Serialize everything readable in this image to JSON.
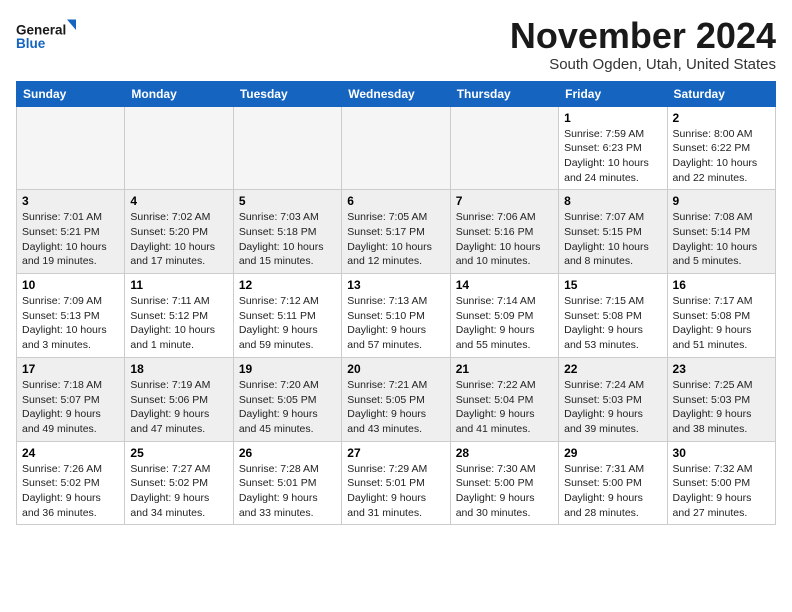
{
  "logo": {
    "line1": "General",
    "line2": "Blue"
  },
  "title": "November 2024",
  "subtitle": "South Ogden, Utah, United States",
  "weekdays": [
    "Sunday",
    "Monday",
    "Tuesday",
    "Wednesday",
    "Thursday",
    "Friday",
    "Saturday"
  ],
  "weeks": [
    [
      {
        "day": "",
        "info": ""
      },
      {
        "day": "",
        "info": ""
      },
      {
        "day": "",
        "info": ""
      },
      {
        "day": "",
        "info": ""
      },
      {
        "day": "",
        "info": ""
      },
      {
        "day": "1",
        "info": "Sunrise: 7:59 AM\nSunset: 6:23 PM\nDaylight: 10 hours\nand 24 minutes."
      },
      {
        "day": "2",
        "info": "Sunrise: 8:00 AM\nSunset: 6:22 PM\nDaylight: 10 hours\nand 22 minutes."
      }
    ],
    [
      {
        "day": "3",
        "info": "Sunrise: 7:01 AM\nSunset: 5:21 PM\nDaylight: 10 hours\nand 19 minutes."
      },
      {
        "day": "4",
        "info": "Sunrise: 7:02 AM\nSunset: 5:20 PM\nDaylight: 10 hours\nand 17 minutes."
      },
      {
        "day": "5",
        "info": "Sunrise: 7:03 AM\nSunset: 5:18 PM\nDaylight: 10 hours\nand 15 minutes."
      },
      {
        "day": "6",
        "info": "Sunrise: 7:05 AM\nSunset: 5:17 PM\nDaylight: 10 hours\nand 12 minutes."
      },
      {
        "day": "7",
        "info": "Sunrise: 7:06 AM\nSunset: 5:16 PM\nDaylight: 10 hours\nand 10 minutes."
      },
      {
        "day": "8",
        "info": "Sunrise: 7:07 AM\nSunset: 5:15 PM\nDaylight: 10 hours\nand 8 minutes."
      },
      {
        "day": "9",
        "info": "Sunrise: 7:08 AM\nSunset: 5:14 PM\nDaylight: 10 hours\nand 5 minutes."
      }
    ],
    [
      {
        "day": "10",
        "info": "Sunrise: 7:09 AM\nSunset: 5:13 PM\nDaylight: 10 hours\nand 3 minutes."
      },
      {
        "day": "11",
        "info": "Sunrise: 7:11 AM\nSunset: 5:12 PM\nDaylight: 10 hours\nand 1 minute."
      },
      {
        "day": "12",
        "info": "Sunrise: 7:12 AM\nSunset: 5:11 PM\nDaylight: 9 hours\nand 59 minutes."
      },
      {
        "day": "13",
        "info": "Sunrise: 7:13 AM\nSunset: 5:10 PM\nDaylight: 9 hours\nand 57 minutes."
      },
      {
        "day": "14",
        "info": "Sunrise: 7:14 AM\nSunset: 5:09 PM\nDaylight: 9 hours\nand 55 minutes."
      },
      {
        "day": "15",
        "info": "Sunrise: 7:15 AM\nSunset: 5:08 PM\nDaylight: 9 hours\nand 53 minutes."
      },
      {
        "day": "16",
        "info": "Sunrise: 7:17 AM\nSunset: 5:08 PM\nDaylight: 9 hours\nand 51 minutes."
      }
    ],
    [
      {
        "day": "17",
        "info": "Sunrise: 7:18 AM\nSunset: 5:07 PM\nDaylight: 9 hours\nand 49 minutes."
      },
      {
        "day": "18",
        "info": "Sunrise: 7:19 AM\nSunset: 5:06 PM\nDaylight: 9 hours\nand 47 minutes."
      },
      {
        "day": "19",
        "info": "Sunrise: 7:20 AM\nSunset: 5:05 PM\nDaylight: 9 hours\nand 45 minutes."
      },
      {
        "day": "20",
        "info": "Sunrise: 7:21 AM\nSunset: 5:05 PM\nDaylight: 9 hours\nand 43 minutes."
      },
      {
        "day": "21",
        "info": "Sunrise: 7:22 AM\nSunset: 5:04 PM\nDaylight: 9 hours\nand 41 minutes."
      },
      {
        "day": "22",
        "info": "Sunrise: 7:24 AM\nSunset: 5:03 PM\nDaylight: 9 hours\nand 39 minutes."
      },
      {
        "day": "23",
        "info": "Sunrise: 7:25 AM\nSunset: 5:03 PM\nDaylight: 9 hours\nand 38 minutes."
      }
    ],
    [
      {
        "day": "24",
        "info": "Sunrise: 7:26 AM\nSunset: 5:02 PM\nDaylight: 9 hours\nand 36 minutes."
      },
      {
        "day": "25",
        "info": "Sunrise: 7:27 AM\nSunset: 5:02 PM\nDaylight: 9 hours\nand 34 minutes."
      },
      {
        "day": "26",
        "info": "Sunrise: 7:28 AM\nSunset: 5:01 PM\nDaylight: 9 hours\nand 33 minutes."
      },
      {
        "day": "27",
        "info": "Sunrise: 7:29 AM\nSunset: 5:01 PM\nDaylight: 9 hours\nand 31 minutes."
      },
      {
        "day": "28",
        "info": "Sunrise: 7:30 AM\nSunset: 5:00 PM\nDaylight: 9 hours\nand 30 minutes."
      },
      {
        "day": "29",
        "info": "Sunrise: 7:31 AM\nSunset: 5:00 PM\nDaylight: 9 hours\nand 28 minutes."
      },
      {
        "day": "30",
        "info": "Sunrise: 7:32 AM\nSunset: 5:00 PM\nDaylight: 9 hours\nand 27 minutes."
      }
    ]
  ]
}
